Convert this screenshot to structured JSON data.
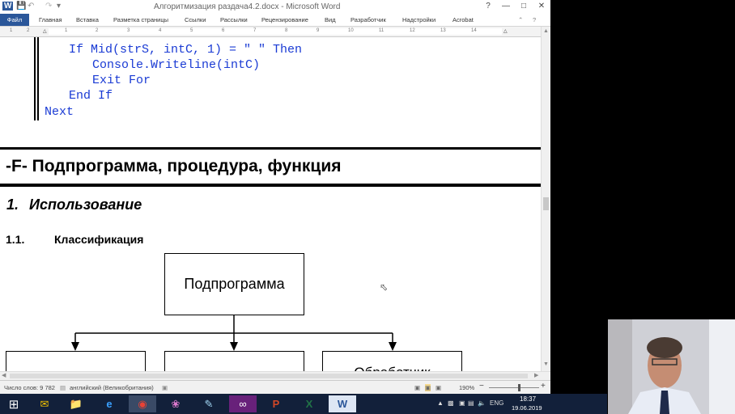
{
  "window": {
    "title": "Алгоритмизация раздача4.2.docx - Microsoft Word",
    "app_icon": "W"
  },
  "ribbon": {
    "tabs": [
      "Файл",
      "Главная",
      "Вставка",
      "Разметка страницы",
      "Ссылки",
      "Рассылки",
      "Рецензирование",
      "Вид",
      "Разработчик",
      "Надстройки",
      "Acrobat"
    ]
  },
  "ruler": {
    "numbers": [
      "1",
      "2",
      "1",
      "1",
      "2",
      "3",
      "4",
      "5",
      "6",
      "7",
      "8",
      "9",
      "10",
      "11",
      "12",
      "13",
      "14"
    ]
  },
  "document": {
    "code_lines": [
      "If Mid(strS, intC, 1) = \" \" Then",
      "Console.Writeline(intC)",
      "Exit For",
      "End If",
      "Next"
    ],
    "heading_f": "-F- Подпрограмма, процедура, функция",
    "heading_1": {
      "num": "1.",
      "text": "Использование"
    },
    "heading_11": {
      "num": "1.1.",
      "text": "Классификация"
    },
    "diagram": {
      "root": "Подпрограмма",
      "children": [
        "",
        "",
        "Обработчик"
      ]
    }
  },
  "statusbar": {
    "word_count": "Число слов: 9 782",
    "language": "английский (Великобритания)",
    "zoom": "190%",
    "zoom_minus": "−",
    "zoom_plus": "+"
  },
  "taskbar": {
    "lang": "ENG",
    "time": "18:37",
    "date": "19.06.2019"
  },
  "colors": {
    "code": "#1a3bd4",
    "word_blue": "#2b579a",
    "taskbar": "#12203a"
  }
}
